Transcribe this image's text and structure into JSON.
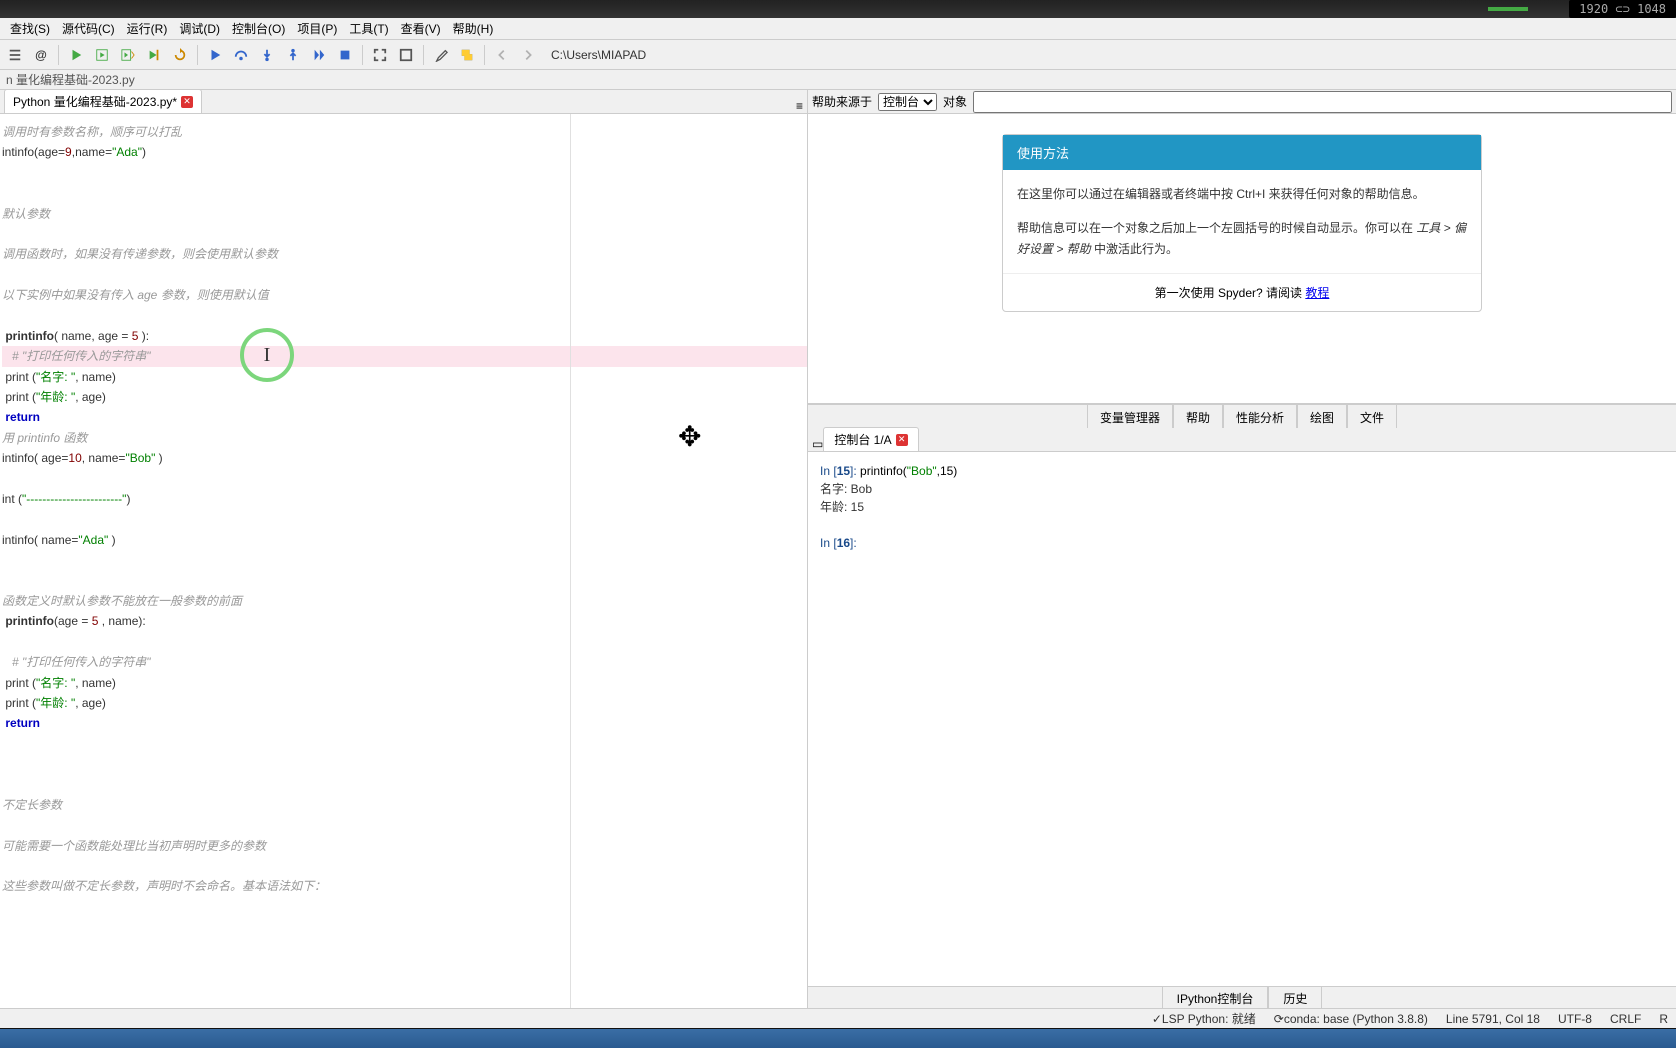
{
  "titlebar": {
    "resolution": "1920 ⊂⊃ 1048"
  },
  "menu": {
    "items": [
      "查找(S)",
      "源代码(C)",
      "运行(R)",
      "调试(D)",
      "控制台(O)",
      "项目(P)",
      "工具(T)",
      "查看(V)",
      "帮助(H)"
    ]
  },
  "toolbar": {
    "path": "C:\\Users\\MIAPAD"
  },
  "breadcrumb": {
    "text": "n 量化编程基础-2023.py"
  },
  "editor": {
    "tab_label": "Python 量化编程基础-2023.py*",
    "lines": [
      {
        "t": "comment",
        "text": "调用时有参数名称，顺序可以打乱"
      },
      {
        "t": "code",
        "raw": "intinfo(age=9,name=\"Ada\")"
      },
      {
        "t": "blank"
      },
      {
        "t": "blank"
      },
      {
        "t": "comment",
        "text": "默认参数"
      },
      {
        "t": "blank"
      },
      {
        "t": "comment",
        "text": "调用函数时，如果没有传递参数，则会使用默认参数"
      },
      {
        "t": "blank"
      },
      {
        "t": "comment",
        "text": "以下实例中如果没有传入 age 参数，则使用默认值"
      },
      {
        "t": "blank"
      },
      {
        "t": "def",
        "name": "printinfo",
        "params": "( name, age = 5 ):"
      },
      {
        "t": "comment_hl",
        "text": "   # \"打印任何传入的字符串\""
      },
      {
        "t": "print",
        "label": "名字: ",
        "var": "name"
      },
      {
        "t": "print",
        "label": "年龄: ",
        "var": "age"
      },
      {
        "t": "return"
      },
      {
        "t": "comment",
        "text": "用 printinfo 函数"
      },
      {
        "t": "code",
        "raw": "intinfo( age=10, name=\"Bob\" )"
      },
      {
        "t": "blank"
      },
      {
        "t": "code",
        "raw": "int (\"------------------------\")"
      },
      {
        "t": "blank"
      },
      {
        "t": "code",
        "raw": "intinfo( name=\"Ada\" )"
      },
      {
        "t": "blank"
      },
      {
        "t": "blank"
      },
      {
        "t": "comment",
        "text": "函数定义时默认参数不能放在一般参数的前面"
      },
      {
        "t": "def",
        "name": "printinfo",
        "params": "(age = 5 , name):"
      },
      {
        "t": "blank"
      },
      {
        "t": "comment",
        "text": "   # \"打印任何传入的字符串\""
      },
      {
        "t": "print",
        "label": "名字: ",
        "var": "name"
      },
      {
        "t": "print",
        "label": "年龄: ",
        "var": "age"
      },
      {
        "t": "return"
      },
      {
        "t": "blank"
      },
      {
        "t": "blank"
      },
      {
        "t": "blank"
      },
      {
        "t": "comment",
        "text": "不定长参数"
      },
      {
        "t": "blank"
      },
      {
        "t": "comment",
        "text": "可能需要一个函数能处理比当初声明时更多的参数"
      },
      {
        "t": "blank"
      },
      {
        "t": "comment",
        "text": "这些参数叫做不定长参数，声明时不会命名。基本语法如下："
      }
    ]
  },
  "help": {
    "source_label": "帮助来源于",
    "source_options": [
      "控制台"
    ],
    "object_label": "对象",
    "card_title": "使用方法",
    "body1": "在这里你可以通过在编辑器或者终端中按 Ctrl+I 来获得任何对象的帮助信息。",
    "body2_pre": "帮助信息可以在一个对象之后加上一个左圆括号的时候自动显示。你可以在 ",
    "body2_path": "工具 > 偏好设置 > 帮助",
    "body2_post": " 中激活此行为。",
    "footer_text": "第一次使用 Spyder? 请阅读 ",
    "footer_link": "教程",
    "tabs": [
      "变量管理器",
      "帮助",
      "性能分析",
      "绘图",
      "文件"
    ]
  },
  "console": {
    "tab_label": "控制台 1/A",
    "in_prefix": "In [",
    "out_lines": [
      {
        "prompt": "15",
        "code": "printinfo(\"Bob\",15)"
      },
      {
        "out": "名字:   Bob"
      },
      {
        "out": "年龄:   15"
      },
      {
        "blank": true
      },
      {
        "prompt": "16",
        "code": ""
      }
    ],
    "bottom_tabs": [
      "IPython控制台",
      "历史"
    ]
  },
  "status": {
    "lsp": "LSP Python: 就绪",
    "conda": "conda: base (Python 3.8.8)",
    "line": "Line 5791, Col 18",
    "enc": "UTF-8",
    "eol": "CRLF",
    "rw": "R"
  },
  "green_cursor": "I"
}
